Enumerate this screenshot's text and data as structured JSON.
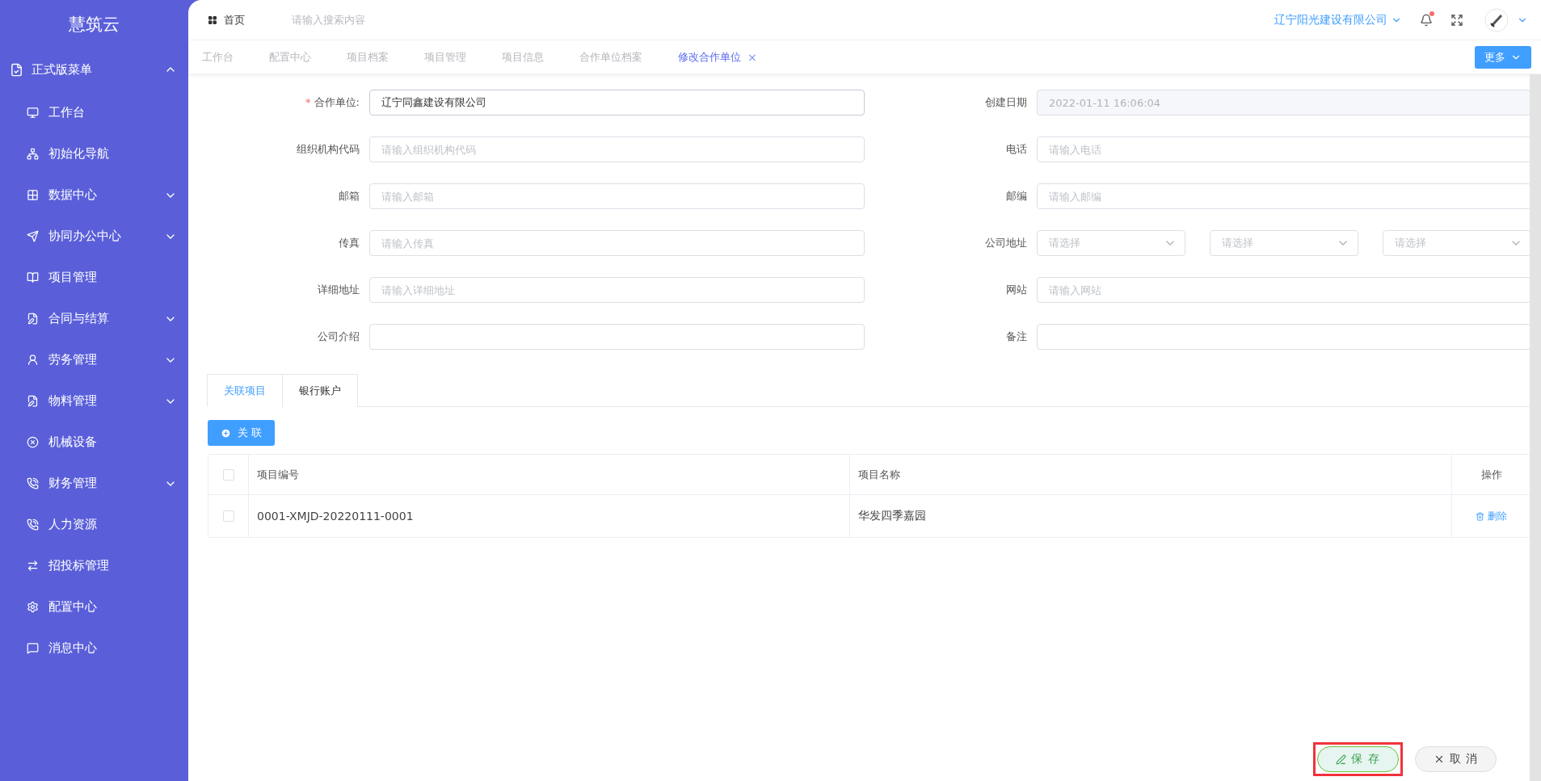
{
  "sidebar": {
    "title": "慧筑云",
    "menu": {
      "label": "正式版菜单",
      "expanded": true,
      "items": [
        {
          "label": "工作台",
          "kind": "link"
        },
        {
          "label": "初始化导航",
          "kind": "link"
        },
        {
          "label": "数据中心",
          "kind": "submenu"
        },
        {
          "label": "协同办公中心",
          "kind": "submenu"
        },
        {
          "label": "项目管理",
          "kind": "link"
        },
        {
          "label": "合同与结算",
          "kind": "submenu"
        },
        {
          "label": "劳务管理",
          "kind": "submenu"
        },
        {
          "label": "物料管理",
          "kind": "submenu"
        },
        {
          "label": "机械设备",
          "kind": "link"
        },
        {
          "label": "财务管理",
          "kind": "submenu"
        },
        {
          "label": "人力资源",
          "kind": "link"
        },
        {
          "label": "招投标管理",
          "kind": "link"
        },
        {
          "label": "配置中心",
          "kind": "link"
        },
        {
          "label": "消息中心",
          "kind": "link"
        }
      ]
    }
  },
  "header": {
    "home": "首页",
    "search": {
      "placeholder": "请输入搜索内容"
    },
    "company": "辽宁阳光建设有限公司",
    "notification": true
  },
  "tabs": [
    {
      "label": "工作台",
      "selected": false
    },
    {
      "label": "配置中心",
      "selected": false
    },
    {
      "label": "项目档案",
      "selected": false
    },
    {
      "label": "项目管理",
      "selected": false
    },
    {
      "label": "项目信息",
      "selected": false
    },
    {
      "label": "合作单位档案",
      "selected": false
    },
    {
      "label": "修改合作单位",
      "selected": true,
      "close": "×"
    }
  ],
  "more_button": "更多",
  "form": {
    "fields": [
      {
        "kind": "input",
        "required_mark": "*",
        "label": "合作单位:",
        "value": "辽宁同鑫建设有限公司",
        "disabled": false
      },
      {
        "kind": "input",
        "label": "创建日期",
        "value": "2022-01-11 16:06:04",
        "disabled": true
      },
      {
        "kind": "input",
        "label": "组织机构代码",
        "placeholder": "请输入组织机构代码"
      },
      {
        "kind": "input",
        "label": "电话",
        "placeholder": "请输入电话"
      },
      {
        "kind": "input",
        "label": "邮箱",
        "placeholder": "请输入邮箱"
      },
      {
        "kind": "input",
        "label": "邮编",
        "placeholder": "请输入邮编"
      },
      {
        "kind": "input",
        "label": "传真",
        "placeholder": "请输入传真"
      },
      {
        "kind": "select_group",
        "label": "公司地址",
        "selects": [
          {
            "placeholder": "请选择"
          },
          {
            "placeholder": "请选择"
          },
          {
            "placeholder": "请选择"
          }
        ]
      },
      {
        "kind": "input",
        "label": "详细地址",
        "placeholder": "请输入详细地址"
      },
      {
        "kind": "input",
        "label": "网站",
        "placeholder": "请输入网站"
      },
      {
        "kind": "input",
        "label": "公司介绍"
      },
      {
        "kind": "input",
        "label": "备注"
      }
    ]
  },
  "subtabs": [
    {
      "label": "关联项目",
      "selected": true
    },
    {
      "label": "银行账户",
      "selected": false
    }
  ],
  "link_button": "关 联",
  "table": {
    "columns": [
      "项目编号",
      "项目名称",
      "操作"
    ],
    "header_checked": false,
    "rows": [
      {
        "checked": false,
        "code": "0001-XMJD-20220111-0001",
        "name": "华发四季嘉园",
        "action": "删除"
      }
    ]
  },
  "actions": [
    {
      "kind": "save",
      "label": "保 存",
      "highlighted": true
    },
    {
      "kind": "cancel",
      "label": "取 消",
      "highlighted": false
    }
  ]
}
